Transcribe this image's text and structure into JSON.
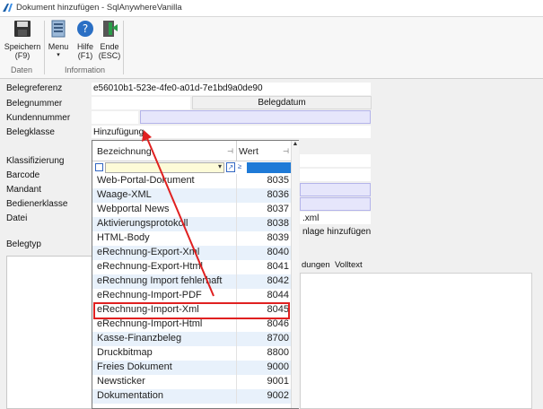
{
  "window": {
    "title": "Dokument hinzufügen - SqlAnywhereVanilla"
  },
  "ribbon": {
    "buttons": [
      {
        "label": "Speichern\n(F9)",
        "icon": "floppy-disk-icon"
      },
      {
        "label": "Menu",
        "icon": "menu-icon",
        "sub": "▾"
      },
      {
        "label": "Hilfe\n(F1)",
        "icon": "help-icon"
      },
      {
        "label": "Ende\n(ESC)",
        "icon": "exit-door-icon"
      }
    ],
    "groups": {
      "daten": "Daten",
      "information": "Information"
    }
  },
  "form": {
    "belegreferenz": {
      "label": "Belegreferenz",
      "value": "e56010b1-523e-4fe0-a01d-7e1bd9a0de90"
    },
    "belegnummer": {
      "label": "Belegnummer"
    },
    "belegdatum_button": "Belegdatum",
    "kundennummer": {
      "label": "Kundennummer"
    },
    "belegklasse": {
      "label": "Belegklasse",
      "value": "Hinzufügung"
    },
    "klassifizierung": {
      "label": "Klassifizierung"
    },
    "barcode": {
      "label": "Barcode"
    },
    "mandant": {
      "label": "Mandant"
    },
    "bedienerklasse": {
      "label": "Bedienerklasse"
    },
    "datei": {
      "label": "Datei",
      "value_fragment": ".xml",
      "link_fragment": "nlage hinzufügen"
    },
    "belegtyp": {
      "label": "Belegtyp"
    },
    "tabs_fragment": {
      "left": "dungen",
      "right": "Volltext"
    }
  },
  "dropdown": {
    "columns": {
      "bezeichnung": "Bezeichnung",
      "wert": "Wert"
    },
    "rows": [
      {
        "name": "Web-Portal-Dokument",
        "value": "8035"
      },
      {
        "name": "Waage-XML",
        "value": "8036"
      },
      {
        "name": "Webportal News",
        "value": "8037"
      },
      {
        "name": "Aktivierungsprotokoll",
        "value": "8038"
      },
      {
        "name": "HTML-Body",
        "value": "8039"
      },
      {
        "name": "eRechnung-Export-Xml",
        "value": "8040"
      },
      {
        "name": "eRechnung-Export-Html",
        "value": "8041"
      },
      {
        "name": "eRechnung Import fehlerhaft",
        "value": "8042"
      },
      {
        "name": "eRechnung-Import-PDF",
        "value": "8044"
      },
      {
        "name": "eRechnung-Import-Xml",
        "value": "8045"
      },
      {
        "name": "eRechnung-Import-Html",
        "value": "8046"
      },
      {
        "name": "Kasse-Finanzbeleg",
        "value": "8700"
      },
      {
        "name": "Druckbitmap",
        "value": "8800"
      },
      {
        "name": "Freies Dokument",
        "value": "9000"
      },
      {
        "name": "Newsticker",
        "value": "9001"
      },
      {
        "name": "Dokumentation",
        "value": "9002"
      }
    ],
    "highlighted_index": 9
  },
  "colors": {
    "highlight": "#e02020",
    "filter_blue": "#1e7ad7",
    "lavender": "#e6e6fb"
  }
}
